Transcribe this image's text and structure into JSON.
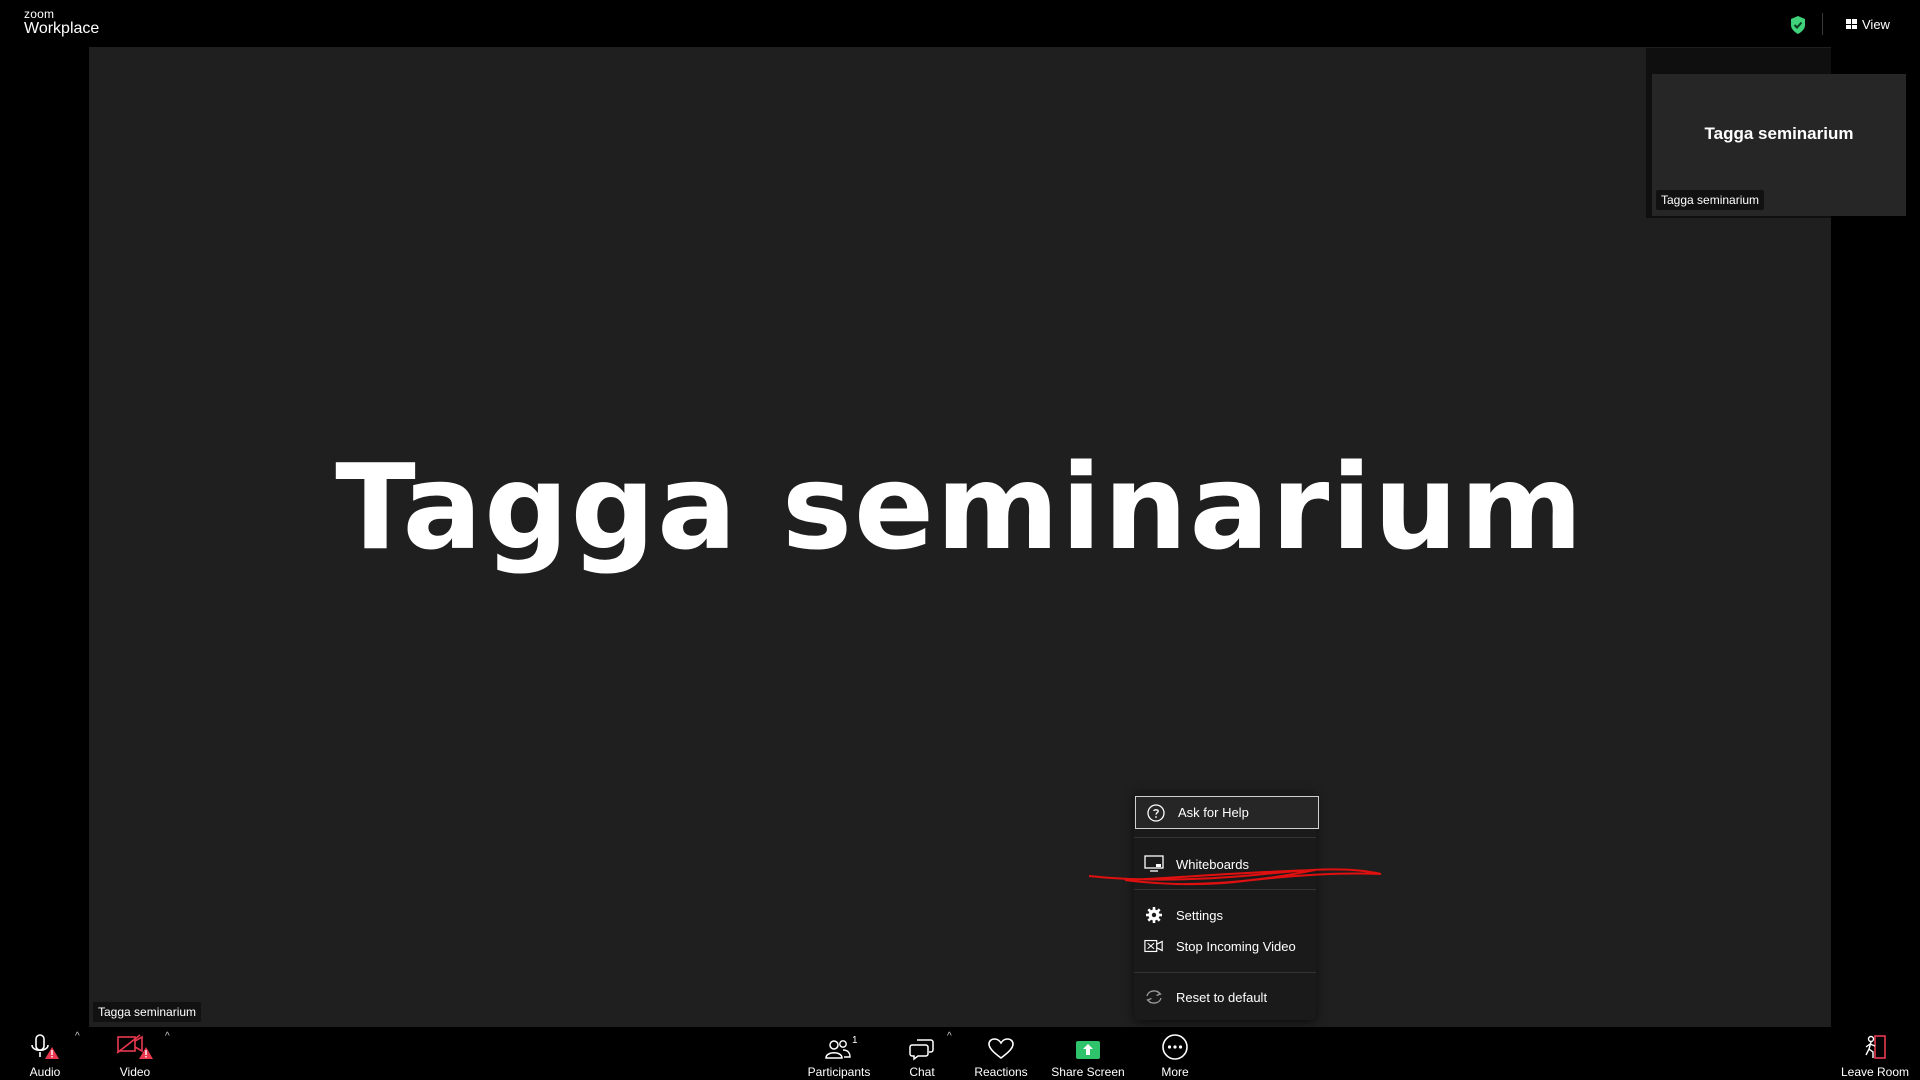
{
  "app": {
    "brand": "zoom",
    "product": "Workplace"
  },
  "header": {
    "view_label": "View"
  },
  "stage": {
    "title": "Tagga seminarium",
    "name_tag": "Tagga seminarium"
  },
  "thumbnail": {
    "name": "Tagga seminarium",
    "name_tag": "Tagga seminarium"
  },
  "more_menu": {
    "items": [
      {
        "label": "Ask for Help",
        "icon": "help-circle-icon"
      },
      {
        "label": "Whiteboards",
        "icon": "whiteboard-icon"
      },
      {
        "label": "Settings",
        "icon": "gear-icon"
      },
      {
        "label": "Stop Incoming Video",
        "icon": "stop-video-icon"
      },
      {
        "label": "Reset to default",
        "icon": "reset-icon"
      }
    ]
  },
  "toolbar": {
    "audio_label": "Audio",
    "video_label": "Video",
    "participants_label": "Participants",
    "participants_count": "1",
    "chat_label": "Chat",
    "reactions_label": "Reactions",
    "share_label": "Share Screen",
    "more_label": "More",
    "leave_label": "Leave Room"
  },
  "colors": {
    "stage_bg": "#1f1f1f",
    "shield_green": "#3fd27a",
    "share_green": "#2fc46b",
    "alert_red": "#e8384f",
    "annotation_red": "#e01010"
  }
}
